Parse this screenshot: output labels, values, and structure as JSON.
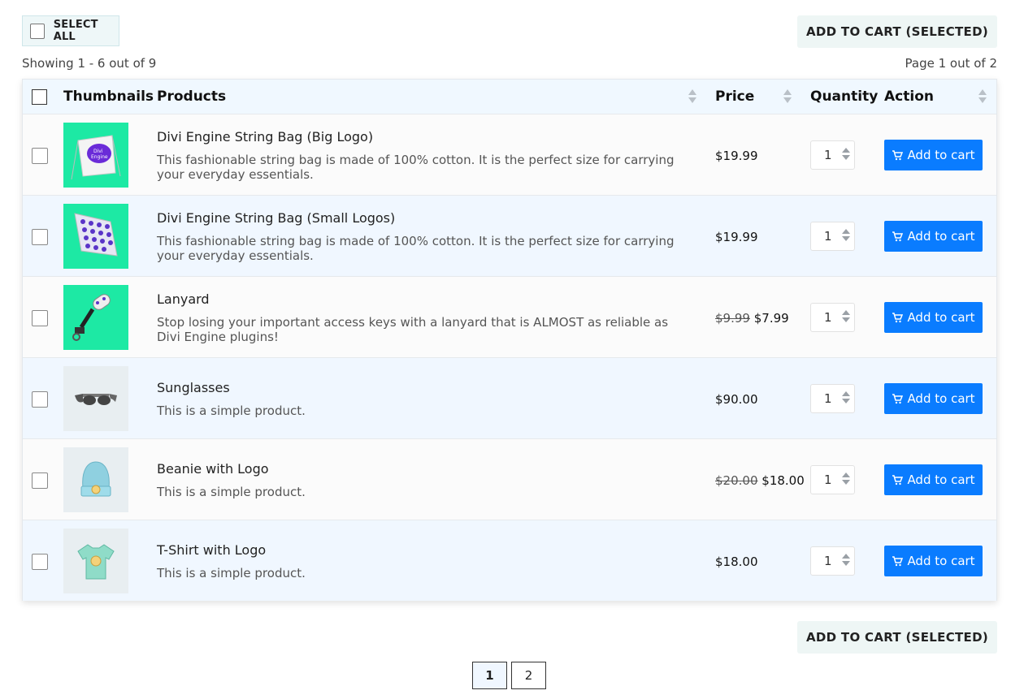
{
  "toolbar": {
    "select_all_label": "SELECT ALL",
    "add_selected_label": "ADD TO CART (SELECTED)",
    "showing": "Showing 1 - 6 out of 9",
    "page_info": "Page 1 out of 2"
  },
  "table": {
    "headers": [
      "Thumbnails",
      "Products",
      "Price",
      "Quantity",
      "Action"
    ],
    "rows": [
      {
        "name": "Divi Engine String Bag (Big Logo)",
        "desc": "This fashionable string bag is made of 100% cotton. It is the perfect size for carrying your everyday essentials.",
        "price": "$19.99",
        "old_price": "",
        "qty": "1",
        "btn": "Add to cart"
      },
      {
        "name": "Divi Engine String Bag (Small Logos)",
        "desc": "This fashionable string bag is made of 100% cotton. It is the perfect size for carrying your everyday essentials.",
        "price": "$19.99",
        "old_price": "",
        "qty": "1",
        "btn": "Add to cart"
      },
      {
        "name": "Lanyard",
        "desc": "Stop losing your important access keys with a lanyard that is ALMOST as reliable as Divi Engine plugins!",
        "price": "$7.99",
        "old_price": "$9.99",
        "qty": "1",
        "btn": "Add to cart"
      },
      {
        "name": "Sunglasses",
        "desc": "This is a simple product.",
        "price": "$90.00",
        "old_price": "",
        "qty": "1",
        "btn": "Add to cart"
      },
      {
        "name": "Beanie with Logo",
        "desc": "This is a simple product.",
        "price": "$18.00",
        "old_price": "$20.00",
        "qty": "1",
        "btn": "Add to cart"
      },
      {
        "name": "T-Shirt with Logo",
        "desc": "This is a simple product.",
        "price": "$18.00",
        "old_price": "",
        "qty": "1",
        "btn": "Add to cart"
      }
    ]
  },
  "pagination": {
    "pages": [
      "1",
      "2"
    ],
    "current": "1"
  },
  "icons": {
    "cart": "cart-icon",
    "sort": "sort-arrows-icon"
  },
  "colors": {
    "accent": "#0a7cff",
    "header_bg": "#f0f8ff",
    "row_alt": "#f0f7ff",
    "thumb_green": "#1de9a4",
    "thumb_grey": "#e8eef1"
  }
}
